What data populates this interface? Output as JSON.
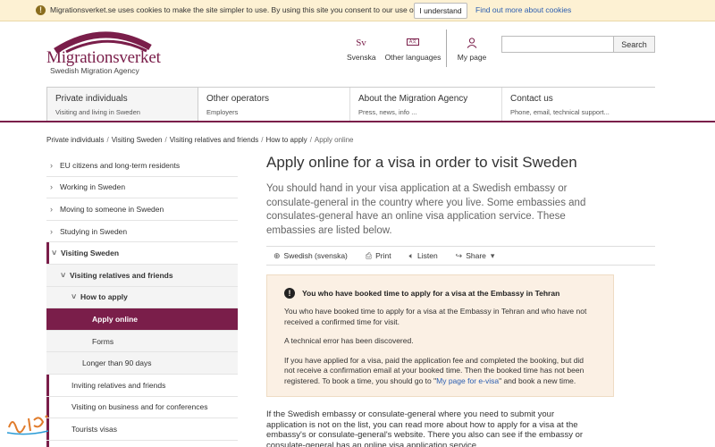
{
  "cookie_bar": {
    "icon": "exclamation-icon",
    "message": "Migrationsverket.se uses cookies to make the site simpler to use. By using this site you consent to our use of cookies.",
    "accept_label": "I understand",
    "more_link": "Find out more about cookies"
  },
  "header": {
    "logo_text": "Migrationsverket",
    "logo_subtitle": "Swedish Migration Agency",
    "brand_color": "#7a1e4a",
    "tools": {
      "svenska_icon_text": "Sv",
      "svenska_label": "Svenska",
      "languages_label": "Other languages",
      "mypage_label": "My page"
    },
    "search": {
      "value": "",
      "button_label": "Search"
    }
  },
  "nav": {
    "tabs": [
      {
        "title": "Private individuals",
        "subtitle": "Visiting and living in Sweden"
      },
      {
        "title": "Other operators",
        "subtitle": "Employers"
      },
      {
        "title": "About the Migration Agency",
        "subtitle": "Press, news, info ..."
      },
      {
        "title": "Contact us",
        "subtitle": "Phone, email, technical support..."
      }
    ]
  },
  "breadcrumb": {
    "items": [
      "Private individuals",
      "Visiting Sweden",
      "Visiting relatives and friends",
      "How to apply"
    ],
    "current": "Apply online"
  },
  "sidebar": {
    "items": [
      "EU citizens and long-term residents",
      "Working in Sweden",
      "Moving to someone in Sweden",
      "Studying in Sweden",
      "Visiting Sweden",
      "Visiting relatives and friends",
      "How to apply",
      "Apply online",
      "Forms",
      "Longer than 90 days",
      "Inviting relatives and friends",
      "Visiting on business and for conferences",
      "Tourists visas"
    ]
  },
  "content": {
    "title": "Apply online for a visa in order to visit Sweden",
    "lead": "You should hand in your visa application at a Swedish embassy or consulate-general in the country where you live. Some embassies and consulates-general have an online visa application service. These embassies are listed below.",
    "toolbar": {
      "language": "Swedish (svenska)",
      "print": "Print",
      "listen": "Listen",
      "share": "Share"
    },
    "alert": {
      "heading": "You who have booked time to apply for a visa at the Embassy in Tehran",
      "p1": "You who have booked time to apply for a visa at the Embassy in Tehran and who have not received a confirmed time for visit.",
      "p2": "A technical error has been discovered.",
      "p3_start": "If you have applied for a visa, paid the application fee and completed the booking, but did not receive a confirmation email at your booked time. Then the booked time has not been registered. To book a time, you should go to \"",
      "p3_link": "My page for e-visa",
      "p3_end": "\" and book a new time."
    },
    "bottom_text": "If the Swedish embassy or consulate-general where you need to submit your application is not on the list, you can read more about how to apply for a visa at the embassy's or consulate-general's website. There you also can see if the embassy or consulate-general has an online visa application service."
  }
}
